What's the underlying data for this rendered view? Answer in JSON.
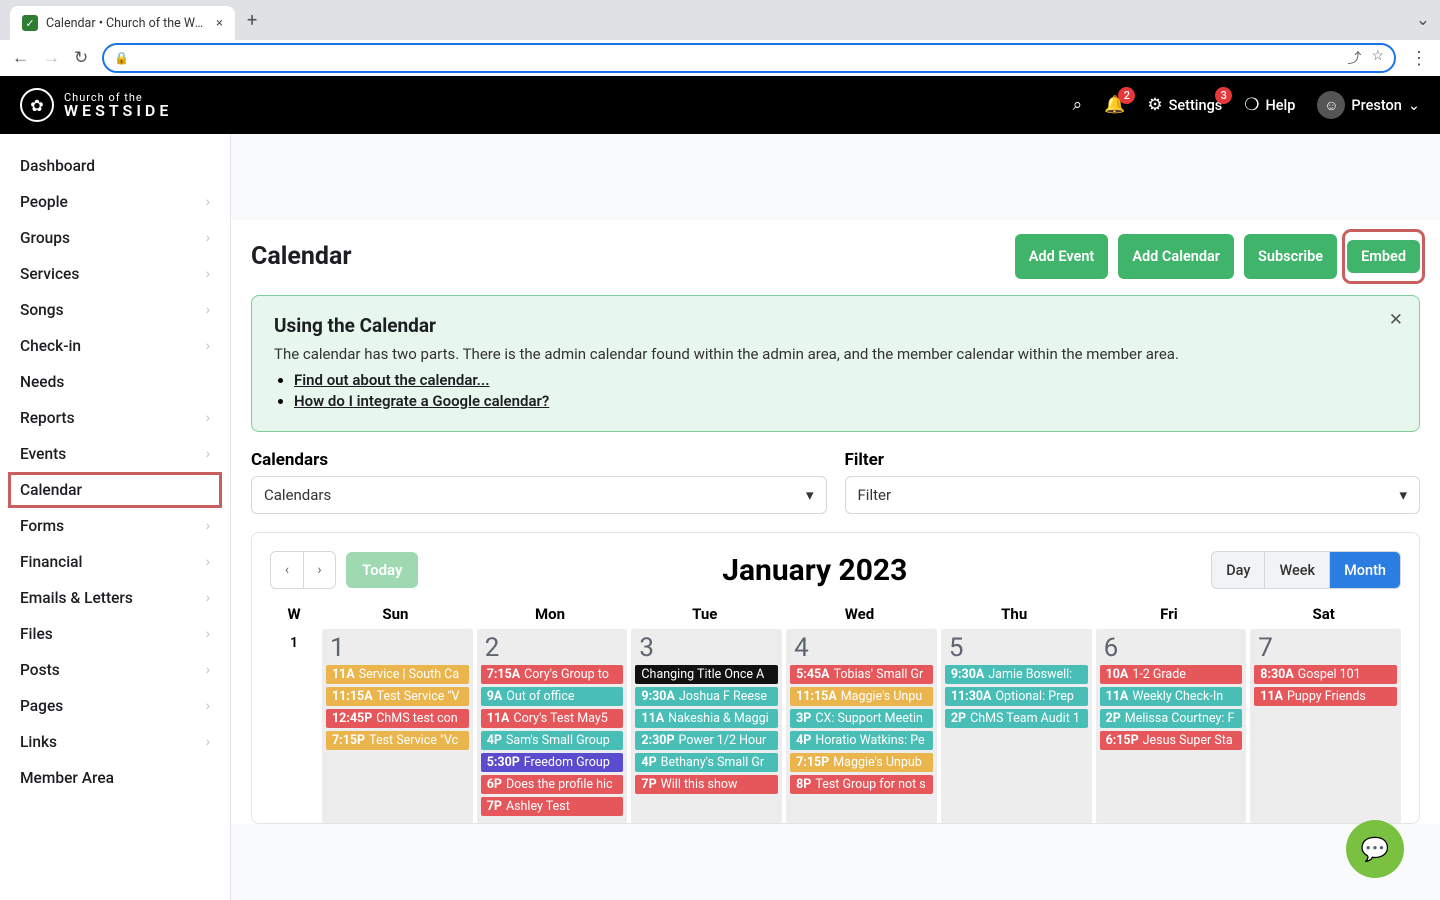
{
  "browser": {
    "tab_title": "Calendar • Church of the West",
    "tab_close": "×",
    "new_tab": "+",
    "back": "←",
    "forward": "→",
    "reload": "↻",
    "lock": "🔒",
    "share": "⤴",
    "star": "☆",
    "more": "⋮",
    "dropdown": "⌄"
  },
  "logo": {
    "line1": "Church of the",
    "line2": "WESTSIDE",
    "mark": "✿"
  },
  "header": {
    "search_icon": "⌕",
    "bell_icon": "🔔",
    "bell_badge": "2",
    "settings_icon": "⚙",
    "settings_label": "Settings",
    "settings_badge": "3",
    "help_icon": "❍",
    "help_label": "Help",
    "user_name": "Preston",
    "chevron": "⌄"
  },
  "sidebar": [
    {
      "label": "Dashboard",
      "sub": false
    },
    {
      "label": "People",
      "sub": true
    },
    {
      "label": "Groups",
      "sub": true
    },
    {
      "label": "Services",
      "sub": true
    },
    {
      "label": "Songs",
      "sub": true
    },
    {
      "label": "Check-in",
      "sub": true
    },
    {
      "label": "Needs",
      "sub": false
    },
    {
      "label": "Reports",
      "sub": true
    },
    {
      "label": "Events",
      "sub": true
    },
    {
      "label": "Calendar",
      "sub": false,
      "active": true
    },
    {
      "label": "Forms",
      "sub": true
    },
    {
      "label": "Financial",
      "sub": true
    },
    {
      "label": "Emails & Letters",
      "sub": true
    },
    {
      "label": "Files",
      "sub": true
    },
    {
      "label": "Posts",
      "sub": true
    },
    {
      "label": "Pages",
      "sub": true
    },
    {
      "label": "Links",
      "sub": true
    },
    {
      "label": "Member Area",
      "sub": false
    }
  ],
  "page": {
    "title": "Calendar",
    "btn_add_event": "Add Event",
    "btn_add_cal": "Add Calendar",
    "btn_subscribe": "Subscribe",
    "btn_embed": "Embed"
  },
  "info": {
    "title": "Using the Calendar",
    "body": "The calendar has two parts. There is the admin calendar found within the admin area, and the member calendar within the member area.",
    "link1": "Find out about the calendar...",
    "link2": "How do I integrate a Google calendar?",
    "close": "✕"
  },
  "filters": {
    "cal_label": "Calendars",
    "cal_value": "Calendars",
    "flt_label": "Filter",
    "flt_value": "Filter",
    "caret": "▾"
  },
  "calendar": {
    "prev": "‹",
    "next": "›",
    "today": "Today",
    "month_title": "January 2023",
    "view_day": "Day",
    "view_week": "Week",
    "view_month": "Month",
    "dow": [
      "W",
      "Sun",
      "Mon",
      "Tue",
      "Wed",
      "Thu",
      "Fri",
      "Sat"
    ],
    "week_num": "1",
    "days": [
      {
        "n": "1",
        "ev": [
          {
            "t": "11A",
            "s": "Service | South Ca",
            "c": "c-yel"
          },
          {
            "t": "11:15A",
            "s": "Test Service \"V",
            "c": "c-yel"
          },
          {
            "t": "12:45P",
            "s": "ChMS test con",
            "c": "c-red"
          },
          {
            "t": "7:15P",
            "s": "Test Service \"Vc",
            "c": "c-yel"
          }
        ]
      },
      {
        "n": "2",
        "ev": [
          {
            "t": "7:15A",
            "s": "Cory's Group to",
            "c": "c-red"
          },
          {
            "t": "9A",
            "s": "Out of office",
            "c": "c-teal"
          },
          {
            "t": "11A",
            "s": "Cory's Test May5",
            "c": "c-red"
          },
          {
            "t": "4P",
            "s": "Sam's Small Group",
            "c": "c-teal"
          },
          {
            "t": "5:30P",
            "s": "Freedom Group",
            "c": "c-pur"
          },
          {
            "t": "6P",
            "s": "Does the profile hic",
            "c": "c-red"
          },
          {
            "t": "7P",
            "s": "Ashley Test",
            "c": "c-red"
          }
        ]
      },
      {
        "n": "3",
        "ev": [
          {
            "t": "",
            "s": "Changing Title Once A",
            "c": "c-blk"
          },
          {
            "t": "9:30A",
            "s": "Joshua F Reese",
            "c": "c-teal"
          },
          {
            "t": "11A",
            "s": "Nakeshia & Maggi",
            "c": "c-teal"
          },
          {
            "t": "2:30P",
            "s": "Power 1/2 Hour",
            "c": "c-teal"
          },
          {
            "t": "4P",
            "s": "Bethany's Small Gr",
            "c": "c-teal"
          },
          {
            "t": "7P",
            "s": "Will this show",
            "c": "c-red"
          }
        ]
      },
      {
        "n": "4",
        "ev": [
          {
            "t": "5:45A",
            "s": "Tobias' Small Gr",
            "c": "c-red"
          },
          {
            "t": "11:15A",
            "s": "Maggie's Unpu",
            "c": "c-yel"
          },
          {
            "t": "3P",
            "s": "CX: Support Meetin",
            "c": "c-teal"
          },
          {
            "t": "4P",
            "s": "Horatio Watkins: Pe",
            "c": "c-teal"
          },
          {
            "t": "7:15P",
            "s": "Maggie's Unpub",
            "c": "c-yel"
          },
          {
            "t": "8P",
            "s": "Test Group for not s",
            "c": "c-red"
          }
        ]
      },
      {
        "n": "5",
        "ev": [
          {
            "t": "9:30A",
            "s": "Jamie Boswell:",
            "c": "c-teal"
          },
          {
            "t": "11:30A",
            "s": "Optional: Prep",
            "c": "c-teal"
          },
          {
            "t": "2P",
            "s": "ChMS Team Audit 1",
            "c": "c-teal"
          }
        ]
      },
      {
        "n": "6",
        "ev": [
          {
            "t": "10A",
            "s": "1-2 Grade",
            "c": "c-red"
          },
          {
            "t": "11A",
            "s": "Weekly Check-In",
            "c": "c-teal"
          },
          {
            "t": "2P",
            "s": "Melissa Courtney: F",
            "c": "c-teal"
          },
          {
            "t": "6:15P",
            "s": "Jesus Super Sta",
            "c": "c-red"
          }
        ]
      },
      {
        "n": "7",
        "ev": [
          {
            "t": "8:30A",
            "s": "Gospel 101",
            "c": "c-red"
          },
          {
            "t": "11A",
            "s": "Puppy Friends",
            "c": "c-red"
          }
        ]
      }
    ]
  },
  "chat_icon": "💬"
}
